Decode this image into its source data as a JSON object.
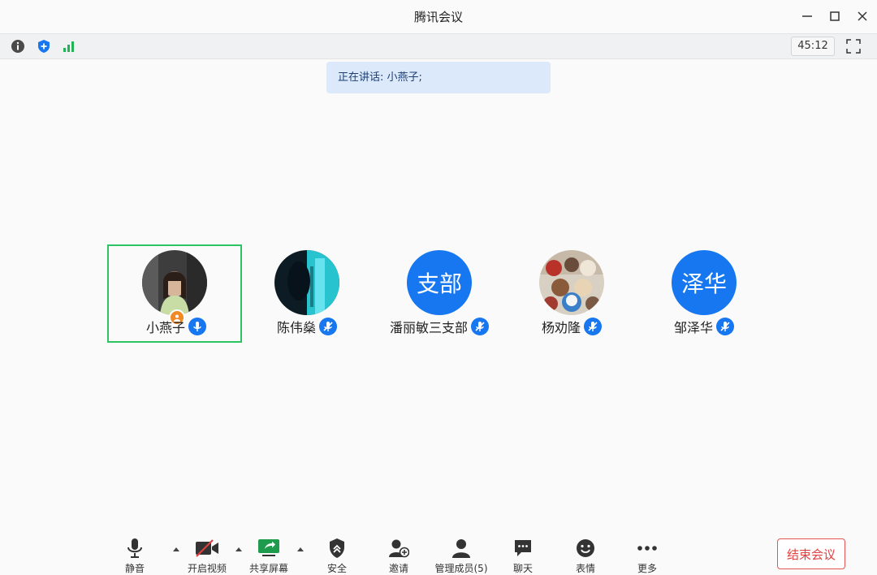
{
  "window": {
    "title": "腾讯会议"
  },
  "status_bar": {
    "timer": "45:12"
  },
  "speaking": {
    "text": "正在讲话: 小燕子;"
  },
  "participants": [
    {
      "name": "小燕子",
      "avatar_text": "",
      "active": true,
      "host": true,
      "mic": "on"
    },
    {
      "name": "陈伟燊",
      "avatar_text": "",
      "active": false,
      "host": false,
      "mic": "muted"
    },
    {
      "name": "潘丽敏三支部",
      "avatar_text": "支部",
      "active": false,
      "host": false,
      "mic": "muted"
    },
    {
      "name": "杨劝隆",
      "avatar_text": "",
      "active": false,
      "host": false,
      "mic": "muted"
    },
    {
      "name": "邹泽华",
      "avatar_text": "泽华",
      "active": false,
      "host": false,
      "mic": "muted"
    }
  ],
  "toolbar": {
    "mute": "静音",
    "video": "开启视频",
    "share": "共享屏幕",
    "security": "安全",
    "invite": "邀请",
    "members": "管理成员(5)",
    "chat": "聊天",
    "emoji": "表情",
    "more": "更多",
    "end": "结束会议"
  },
  "colors": {
    "accent": "#1677f0",
    "active_border": "#2fc463",
    "end": "#e24040",
    "host_badge": "#f08a24"
  }
}
